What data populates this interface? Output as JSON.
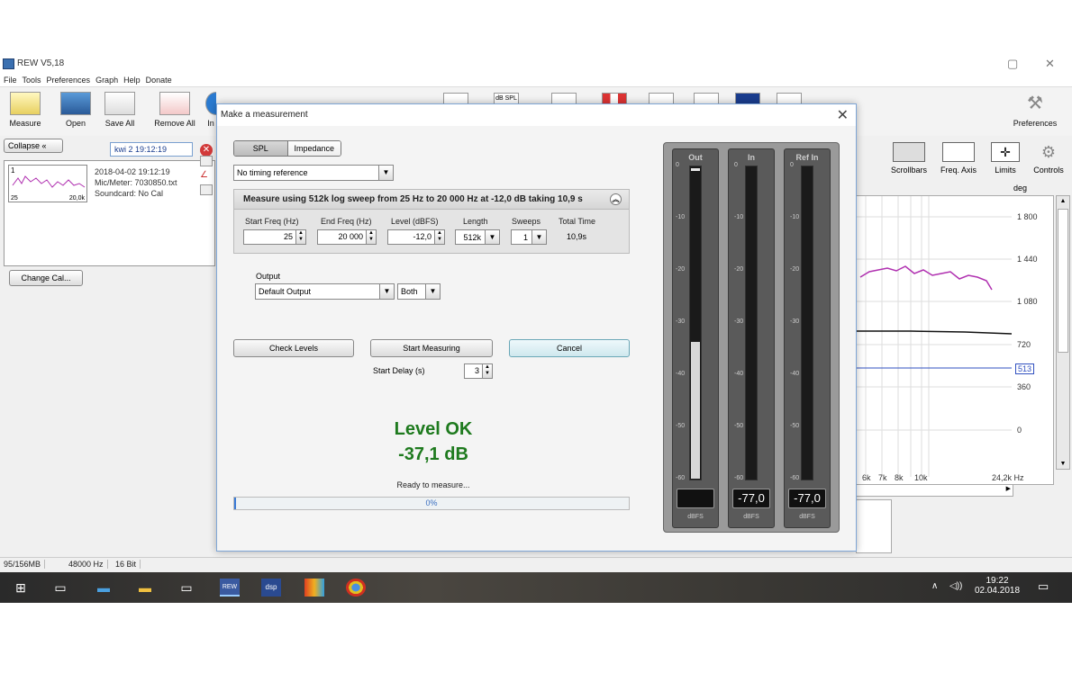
{
  "app": {
    "title": "REW V5,18",
    "menu": [
      "File",
      "Tools",
      "Preferences",
      "Graph",
      "Help",
      "Donate"
    ]
  },
  "toolbar": {
    "buttons": [
      "Measure",
      "Open",
      "Save All",
      "Remove All",
      "In"
    ],
    "top_icon_label": "dB SPL",
    "preferences": "Preferences"
  },
  "left_panel": {
    "collapse_label": "Collapse",
    "measurement_name": "kwi 2 19:12:19",
    "thumb_index": "1",
    "thumb_x_start": "25",
    "thumb_x_end": "20,0k",
    "info_lines": [
      "2018-04-02 19:12:19",
      "Mic/Meter: 7030850.txt",
      "Soundcard: No Cal"
    ],
    "change_cal": "Change Cal..."
  },
  "graph": {
    "tools": [
      "Scrollbars",
      "Freq. Axis",
      "Limits",
      "Controls"
    ],
    "unit": "deg",
    "y_labels": [
      "1 800",
      "1 440",
      "1 080",
      "720",
      "513",
      "360",
      "0"
    ],
    "x_labels": [
      "6k",
      "7k",
      "8k",
      "10k",
      "24,2k Hz"
    ]
  },
  "status": {
    "memory": "95/156MB",
    "rate": "48000 Hz",
    "bits": "16 Bit"
  },
  "taskbar": {
    "time": "19:22",
    "date": "02.04.2018"
  },
  "dialog": {
    "title": "Make a measurement",
    "mode": {
      "spl": "SPL",
      "impedance": "Impedance"
    },
    "timing_reference": "No timing reference",
    "sweep_summary": "Measure using  512k log sweep from 25 Hz to 20 000 Hz at -12,0 dB taking 10,9 s",
    "columns": {
      "start_freq": {
        "label": "Start Freq (Hz)",
        "value": "25"
      },
      "end_freq": {
        "label": "End Freq (Hz)",
        "value": "20 000"
      },
      "level": {
        "label": "Level (dBFS)",
        "value": "-12,0"
      },
      "length": {
        "label": "Length",
        "value": "512k"
      },
      "sweeps": {
        "label": "Sweeps",
        "value": "1"
      },
      "total_time": {
        "label": "Total Time",
        "value": "10,9s"
      }
    },
    "output": {
      "label": "Output",
      "device": "Default Output",
      "channel": "Both"
    },
    "buttons": {
      "check_levels": "Check Levels",
      "start_measuring": "Start Measuring",
      "cancel": "Cancel"
    },
    "start_delay": {
      "label": "Start Delay (s)",
      "value": "3"
    },
    "level_status": "Level OK",
    "level_value": "-37,1 dB",
    "ready_text": "Ready to measure...",
    "progress": {
      "percent": 0,
      "label": "0%"
    },
    "meters": [
      {
        "title": "Out",
        "readout": "",
        "unit": "dBFS",
        "level_fraction": 0.44
      },
      {
        "title": "In",
        "readout": "-77,0",
        "unit": "dBFS",
        "level_fraction": 0.0
      },
      {
        "title": "Ref In",
        "readout": "-77,0",
        "unit": "dBFS",
        "level_fraction": 0.0
      }
    ],
    "meter_ticks": [
      "0",
      "-10",
      "-20",
      "-30",
      "-40",
      "-50",
      "-60"
    ]
  }
}
